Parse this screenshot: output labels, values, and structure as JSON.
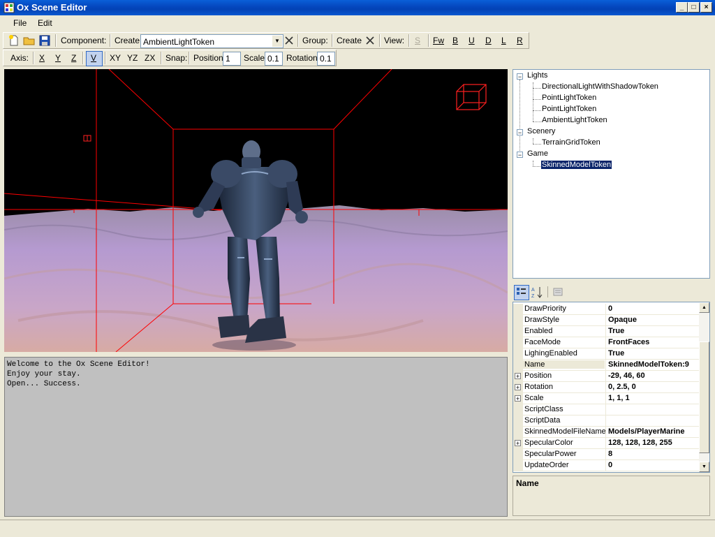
{
  "window": {
    "title": "Ox Scene Editor"
  },
  "menu": {
    "file": "File",
    "edit": "Edit"
  },
  "toolbar1": {
    "component_label": "Component:",
    "create_label": "Create",
    "component_value": "AmbientLightToken",
    "group_label": "Group:",
    "group_create": "Create",
    "view_label": "View:",
    "view_buttons": [
      "S",
      "Fw",
      "B",
      "U",
      "D",
      "L",
      "R"
    ]
  },
  "toolbar2": {
    "axis_label": "Axis:",
    "axis_buttons": [
      "X",
      "Y",
      "Z",
      "V",
      "XY",
      "YZ",
      "ZX"
    ],
    "snap_label": "Snap:",
    "position_label": "Position",
    "position_value": "1",
    "scale_label": "Scale",
    "scale_value": "0.1",
    "rotation_label": "Rotation",
    "rotation_value": "0.1"
  },
  "console": {
    "lines": [
      "Welcome to the Ox Scene Editor!",
      "Enjoy your stay.",
      "Open... Success."
    ]
  },
  "tree": {
    "groups": [
      {
        "label": "Lights",
        "children": [
          "DirectionalLightWithShadowToken",
          "PointLightToken",
          "PointLightToken",
          "AmbientLightToken"
        ]
      },
      {
        "label": "Scenery",
        "children": [
          "TerrainGridToken"
        ]
      },
      {
        "label": "Game",
        "children": [
          "SkinnedModelToken"
        ]
      }
    ]
  },
  "properties": [
    {
      "name": "DrawPriority",
      "value": "0"
    },
    {
      "name": "DrawStyle",
      "value": "Opaque"
    },
    {
      "name": "Enabled",
      "value": "True"
    },
    {
      "name": "FaceMode",
      "value": "FrontFaces"
    },
    {
      "name": "LighingEnabled",
      "value": "True"
    },
    {
      "name": "Name",
      "value": "SkinnedModelToken:9",
      "selected": true
    },
    {
      "name": "Position",
      "value": "-29, 46, 60",
      "expandable": true
    },
    {
      "name": "Rotation",
      "value": "0, 2.5, 0",
      "expandable": true
    },
    {
      "name": "Scale",
      "value": "1, 1, 1",
      "expandable": true
    },
    {
      "name": "ScriptClass",
      "value": ""
    },
    {
      "name": "ScriptData",
      "value": ""
    },
    {
      "name": "SkinnedModelFileName",
      "value": "Models/PlayerMarine"
    },
    {
      "name": "SpecularColor",
      "value": "128, 128, 128, 255",
      "expandable": true
    },
    {
      "name": "SpecularPower",
      "value": "8"
    },
    {
      "name": "UpdateOrder",
      "value": "0"
    }
  ],
  "help": {
    "title": "Name"
  },
  "colors": {
    "titlebar": "#0549c0",
    "wireframe": "#ff0000",
    "selection": "#0a246a"
  }
}
